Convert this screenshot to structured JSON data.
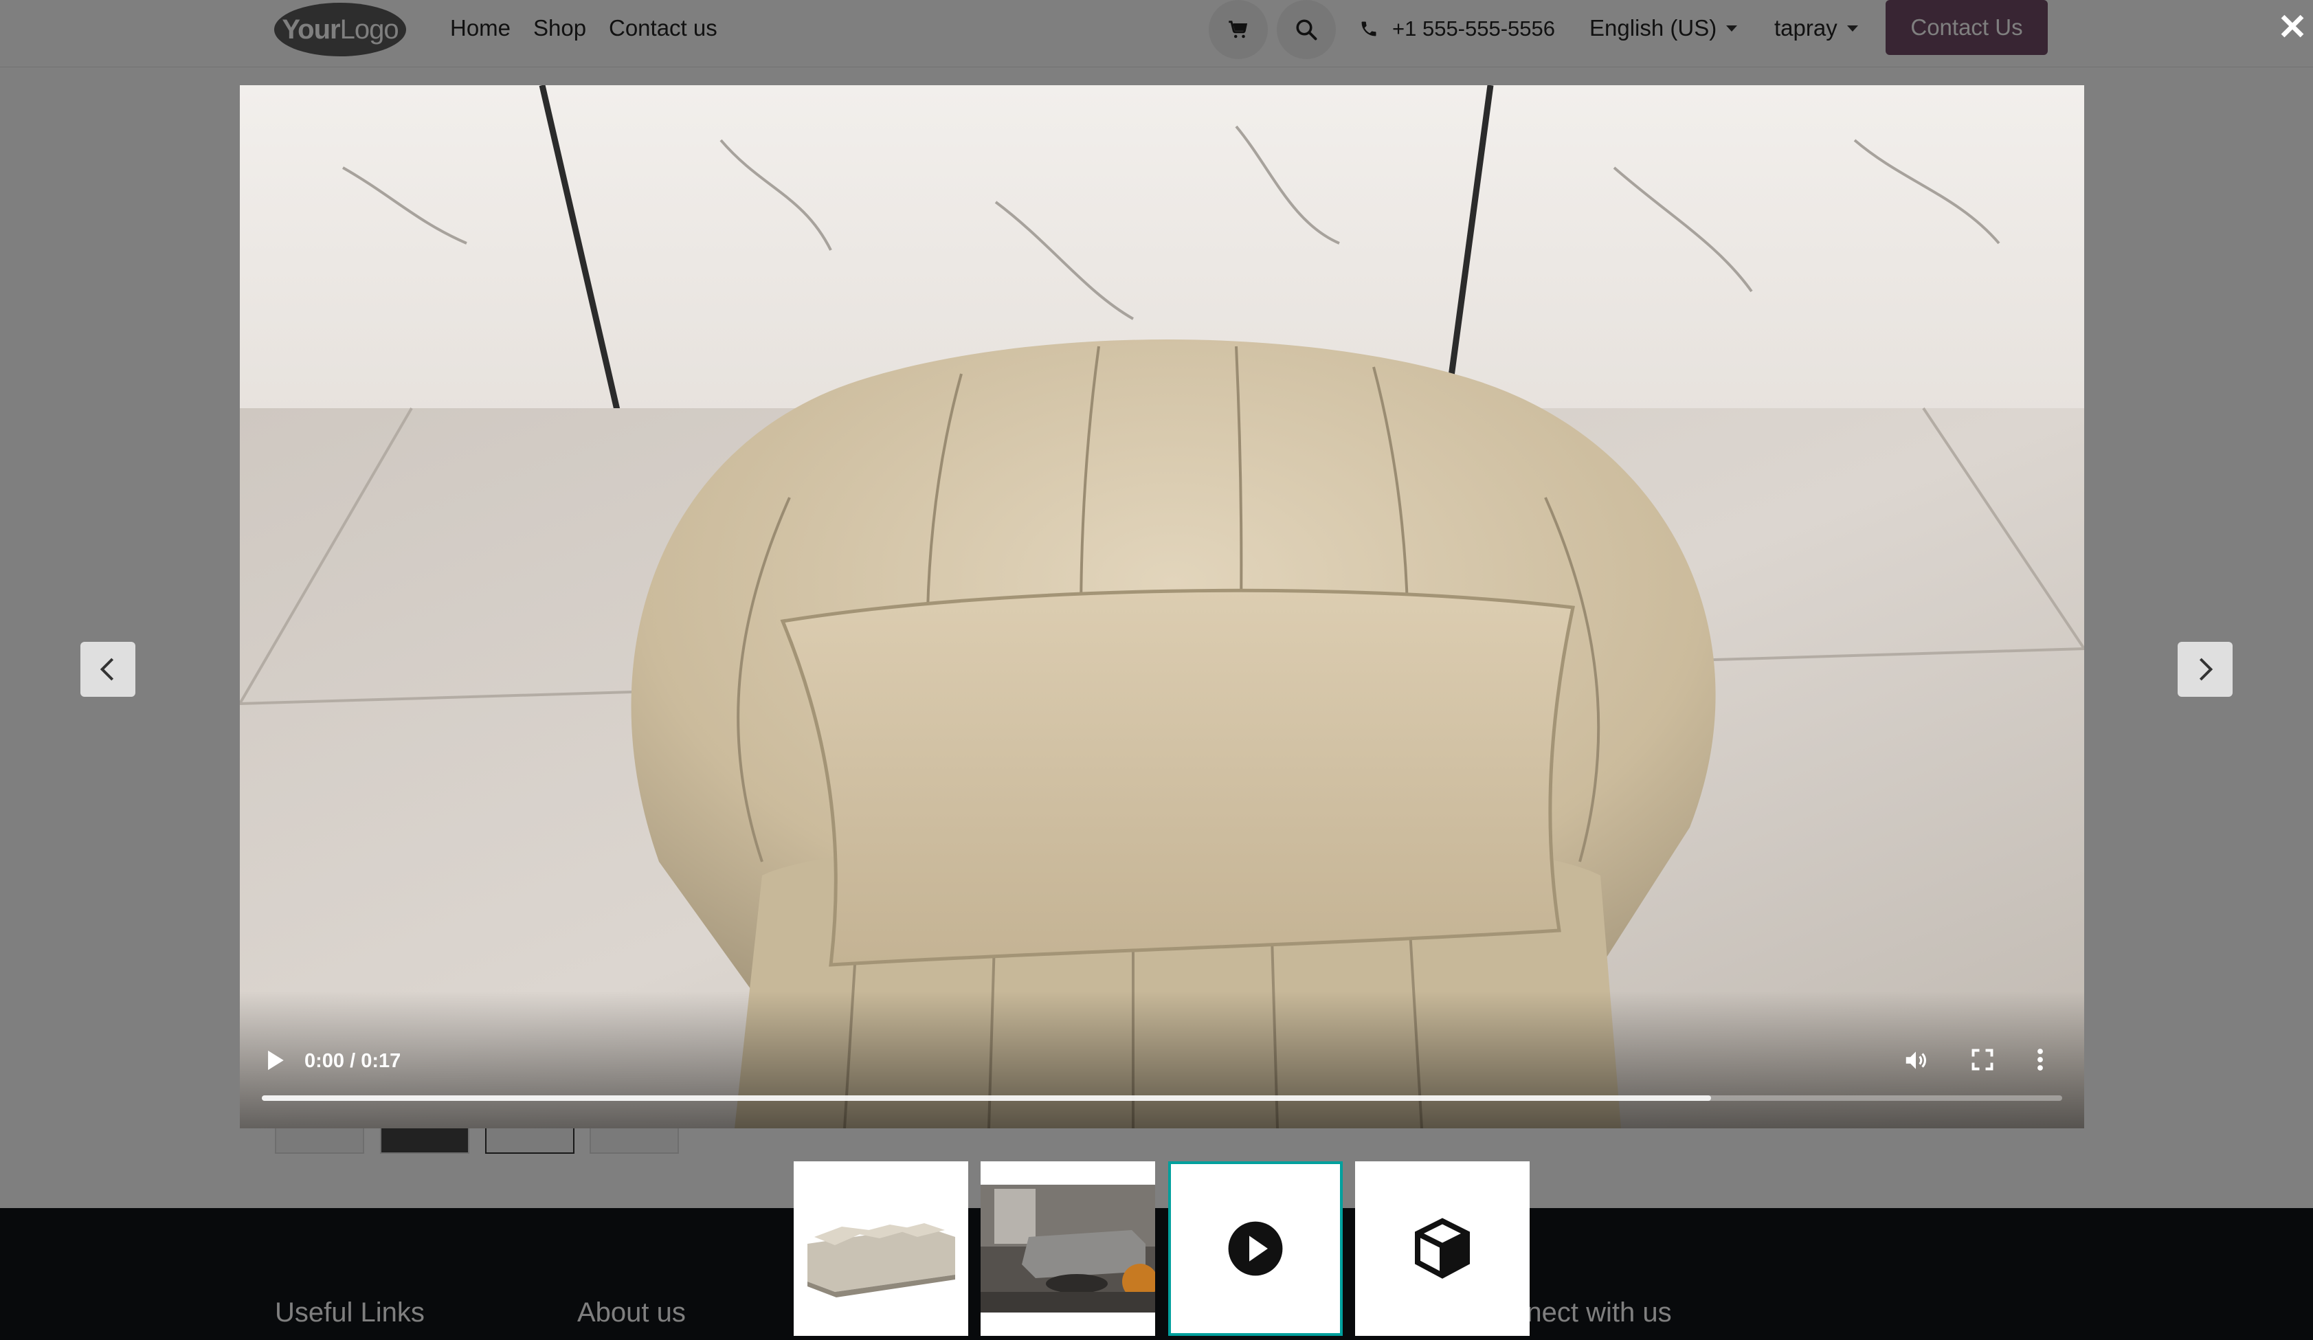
{
  "navbar": {
    "logo_text_bold": "Your",
    "logo_text_light": "Logo",
    "links": [
      "Home",
      "Shop",
      "Contact us"
    ],
    "phone": "+1 555-555-5556",
    "language": "English (US)",
    "user": "tapray",
    "contact_button": "Contact Us"
  },
  "footer": {
    "headings": [
      "Useful Links",
      "About us",
      "Connect with us"
    ]
  },
  "lightbox": {
    "close_icon": "close-icon",
    "prev_icon": "chevron-left-icon",
    "next_icon": "chevron-right-icon",
    "video": {
      "time": "0:00 / 0:17",
      "buffered_fraction": 0.805,
      "icons": [
        "play-icon",
        "volume-icon",
        "fullscreen-icon",
        "more-options-icon"
      ]
    },
    "thumbnails": [
      {
        "name": "sofa-photo",
        "type": "image",
        "active": false
      },
      {
        "name": "living-room-photo",
        "type": "image",
        "active": false
      },
      {
        "name": "video",
        "type": "video",
        "icon": "play-circle-icon",
        "active": true
      },
      {
        "name": "3d-model",
        "type": "model",
        "icon": "cube-icon",
        "active": false
      }
    ]
  },
  "colors": {
    "brand": "#714b67",
    "active_thumb_border": "#00a09d",
    "footer_bg": "#111418",
    "overlay": "rgba(0,0,0,0.5)"
  }
}
